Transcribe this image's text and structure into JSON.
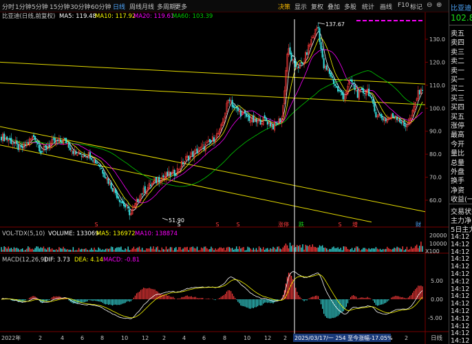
{
  "toolbar": {
    "timeframes": [
      "分时",
      "1分钟",
      "5分钟",
      "15分钟",
      "30分钟",
      "60分钟",
      "日线",
      "周线",
      "月线",
      "多周期",
      "更多"
    ],
    "active_timeframe": "日线",
    "buttons": [
      "决策",
      "显示",
      "复权",
      "叠加",
      "多股",
      "统计",
      "画线",
      "F10",
      "标记"
    ],
    "controls": [
      "⊖",
      "⊕"
    ]
  },
  "sidebar": {
    "stock_name": "比亚迪",
    "price": "102.8",
    "quote_labels": [
      "卖五",
      "卖四",
      "卖三",
      "卖二",
      "卖一",
      "买一",
      "买二",
      "买三",
      "买四",
      "买五",
      "涨停",
      "最高",
      "今开",
      "量比",
      "总量",
      "外盘",
      "换手",
      "净资",
      "收益(一)"
    ],
    "section_labels": [
      "交易状态",
      "主力净",
      "5日主力"
    ],
    "times": [
      "14:12",
      "14:12",
      "14:12",
      "14:12",
      "14:12",
      "14:12",
      "14:12",
      "14:12",
      "14:12",
      "14:12",
      "14:12",
      "14:12",
      "14:12",
      "14:12",
      "14:12"
    ]
  },
  "price_panel": {
    "header_title": "比亚迪(日线,前复权)",
    "ma5": "MA5: 119.48",
    "ma10": "MA10: 117.92",
    "ma20": "MA20: 119.61",
    "ma60": "MA60: 103.39",
    "max_label": "137.67",
    "min_label": "51.90",
    "y_ticks": [
      "130.0",
      "120.0",
      "110.0",
      "100.0",
      "90.0",
      "80.0",
      "70.0",
      "60.0"
    ],
    "markers": [
      "S",
      "S",
      "S",
      "S",
      "涨停",
      "跌",
      "S",
      "S",
      "增",
      "财"
    ]
  },
  "volume_panel": {
    "header": "VOL-TDX(5,10)",
    "volume": "VOLUME: 133069",
    "ma5": "MA5: 136972",
    "ma10": "MA10: 138874",
    "y_ticks": [
      "20000",
      "10000"
    ],
    "unit": "X100"
  },
  "macd_panel": {
    "header": "MACD(12,26,9)",
    "dif": "DIF: 3.73",
    "dea": "DEA: 4.14",
    "macd": "MACD: -0.81",
    "y_ticks": [
      "5.00",
      "0.00",
      "-5.00"
    ]
  },
  "x_axis": {
    "labels": [
      "2022年",
      "2",
      "4",
      "6",
      "8",
      "10",
      "12",
      "2",
      "4",
      "6",
      "8",
      "10",
      "12",
      "2",
      "4",
      "6",
      "8",
      "10",
      "12",
      "2",
      "3"
    ],
    "status_text": "2025/03/17/一 254 至今涨幅-17.05%",
    "period_label": "日线"
  },
  "colors": {
    "up": "#ff3b3b",
    "down": "#36dcdc",
    "ma5": "#ffffff",
    "ma10": "#ffff00",
    "ma20": "#ff00ff",
    "ma60": "#00d000",
    "trend_line": "#e6dc00",
    "accent": "#f0b400"
  }
}
